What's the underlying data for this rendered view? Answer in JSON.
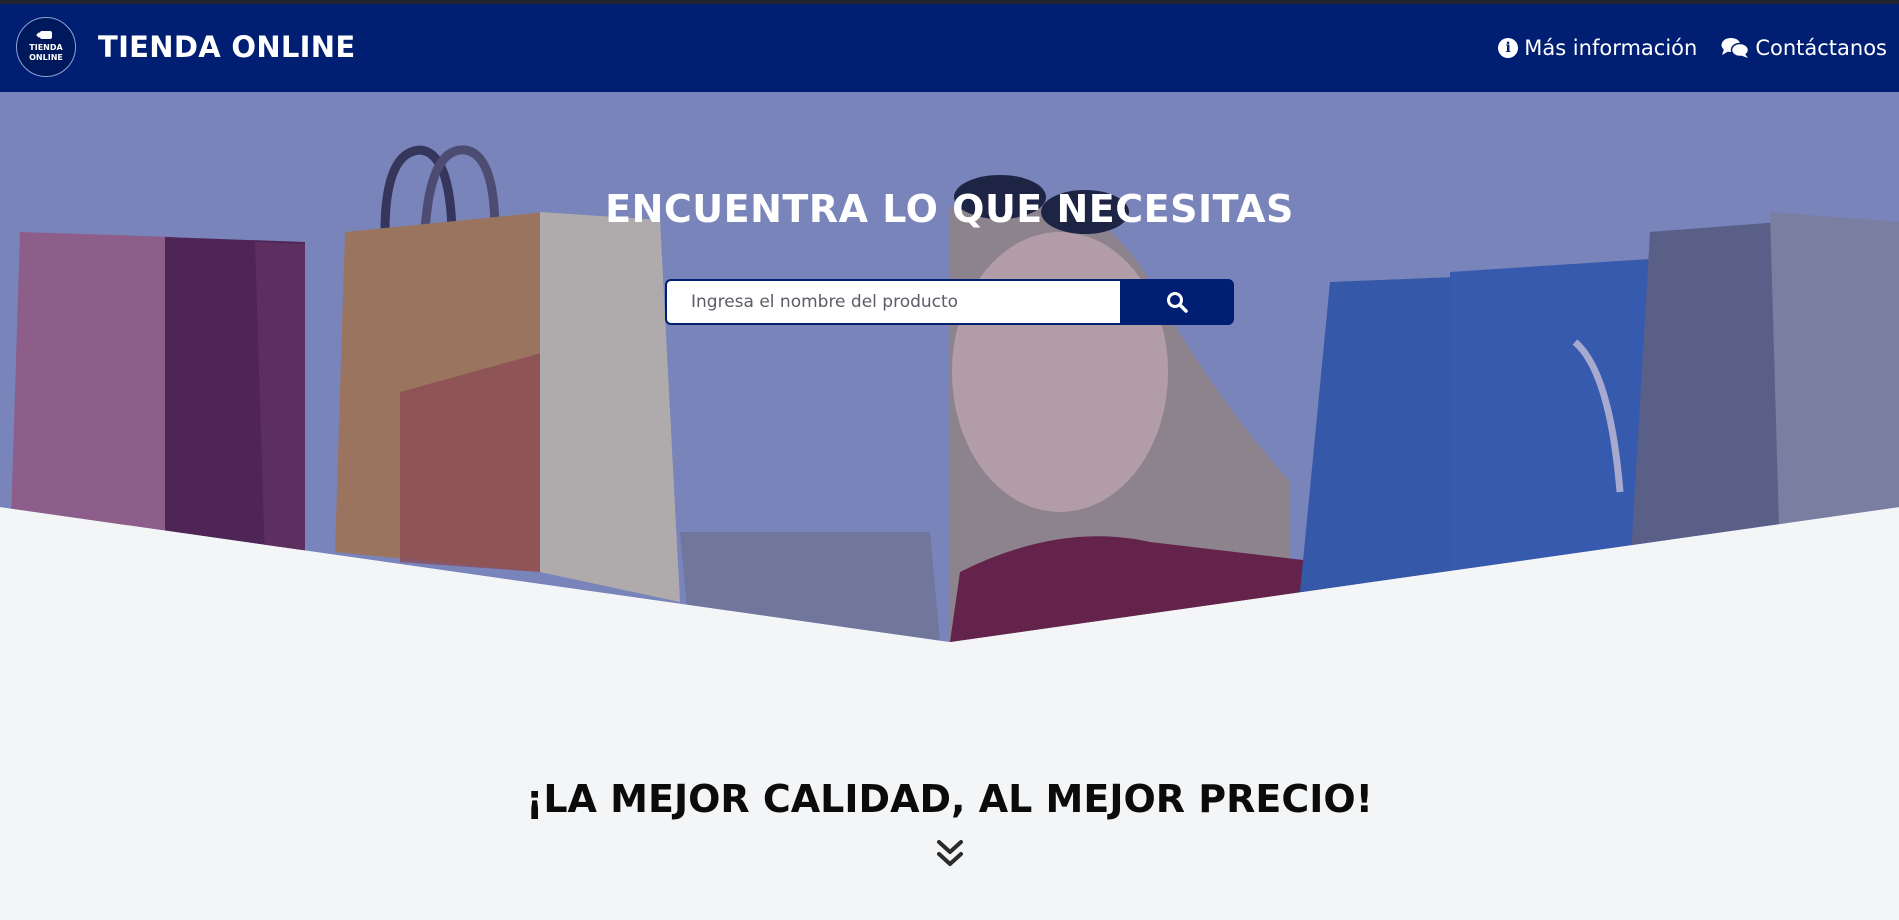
{
  "brand": {
    "logo_line1": "TIENDA",
    "logo_line2": "ONLINE",
    "name": "TIENDA ONLINE"
  },
  "nav": {
    "info_label": "Más información",
    "contact_label": "Contáctanos"
  },
  "hero": {
    "title": "ENCUENTRA LO QUE NECESITAS",
    "search_placeholder": "Ingresa el nombre del producto",
    "search_value": ""
  },
  "tagline": "¡LA MEJOR CALIDAD, AL MEJOR PRECIO!",
  "colors": {
    "primary": "#001f73",
    "page_background": "#f4f5f7"
  },
  "icons": {
    "info": "info-circle-icon",
    "contact": "comments-icon",
    "search": "search-icon",
    "scroll": "double-chevron-down-icon"
  }
}
